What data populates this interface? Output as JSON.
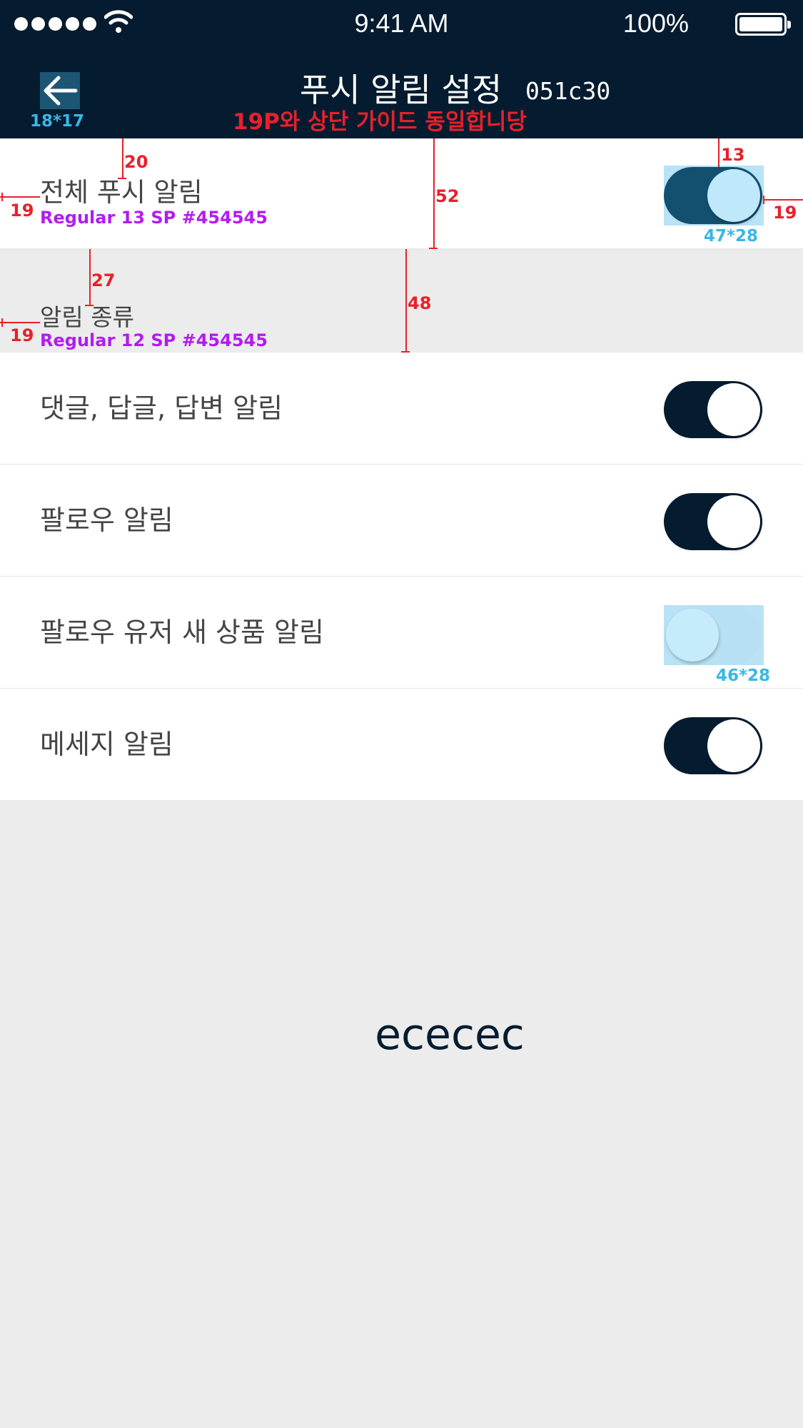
{
  "status_bar": {
    "time": "9:41 AM",
    "battery_percent": "100%",
    "signal_icon": "signal-dots-icon",
    "wifi_icon": "wifi-icon",
    "battery_icon": "battery-icon"
  },
  "header": {
    "title": "푸시 알림 설정",
    "color_note": "051c30",
    "back_icon": "arrow-left-icon",
    "back_size_note": "18*17",
    "guide_note": "19P와 상단 가이드 동일합니당"
  },
  "all_push": {
    "label": "전체 푸시 알림",
    "type_note": "Regular 13 SP #454545",
    "enabled": true,
    "toggle_size_note": "47*28"
  },
  "section": {
    "label": "알림 종류",
    "type_note": "Regular 12 SP #454545"
  },
  "items": [
    {
      "label": "댓글, 답글, 답변 알림",
      "enabled": true
    },
    {
      "label": "팔로우 알림",
      "enabled": true
    },
    {
      "label": "팔로우 유저 새 상품 알림",
      "enabled": false,
      "toggle_size_note": "46*28"
    },
    {
      "label": "메세지 알림",
      "enabled": true
    }
  ],
  "measurements": {
    "top_gap": "20",
    "row_height": "52",
    "left_margin": "19",
    "toggle_top": "13",
    "right_margin": "19",
    "section_gap": "27",
    "section_height": "48",
    "section_left_margin": "19"
  },
  "background_note": "ececec",
  "colors": {
    "header_bg": "#051c30",
    "text": "#454545",
    "page_bg": "#ececec",
    "toggle_on": "#051c30",
    "highlight": "#b8e2f6",
    "guide_red": "#e8202a",
    "guide_blue": "#39b6e6",
    "guide_purple": "#b21cf0"
  }
}
